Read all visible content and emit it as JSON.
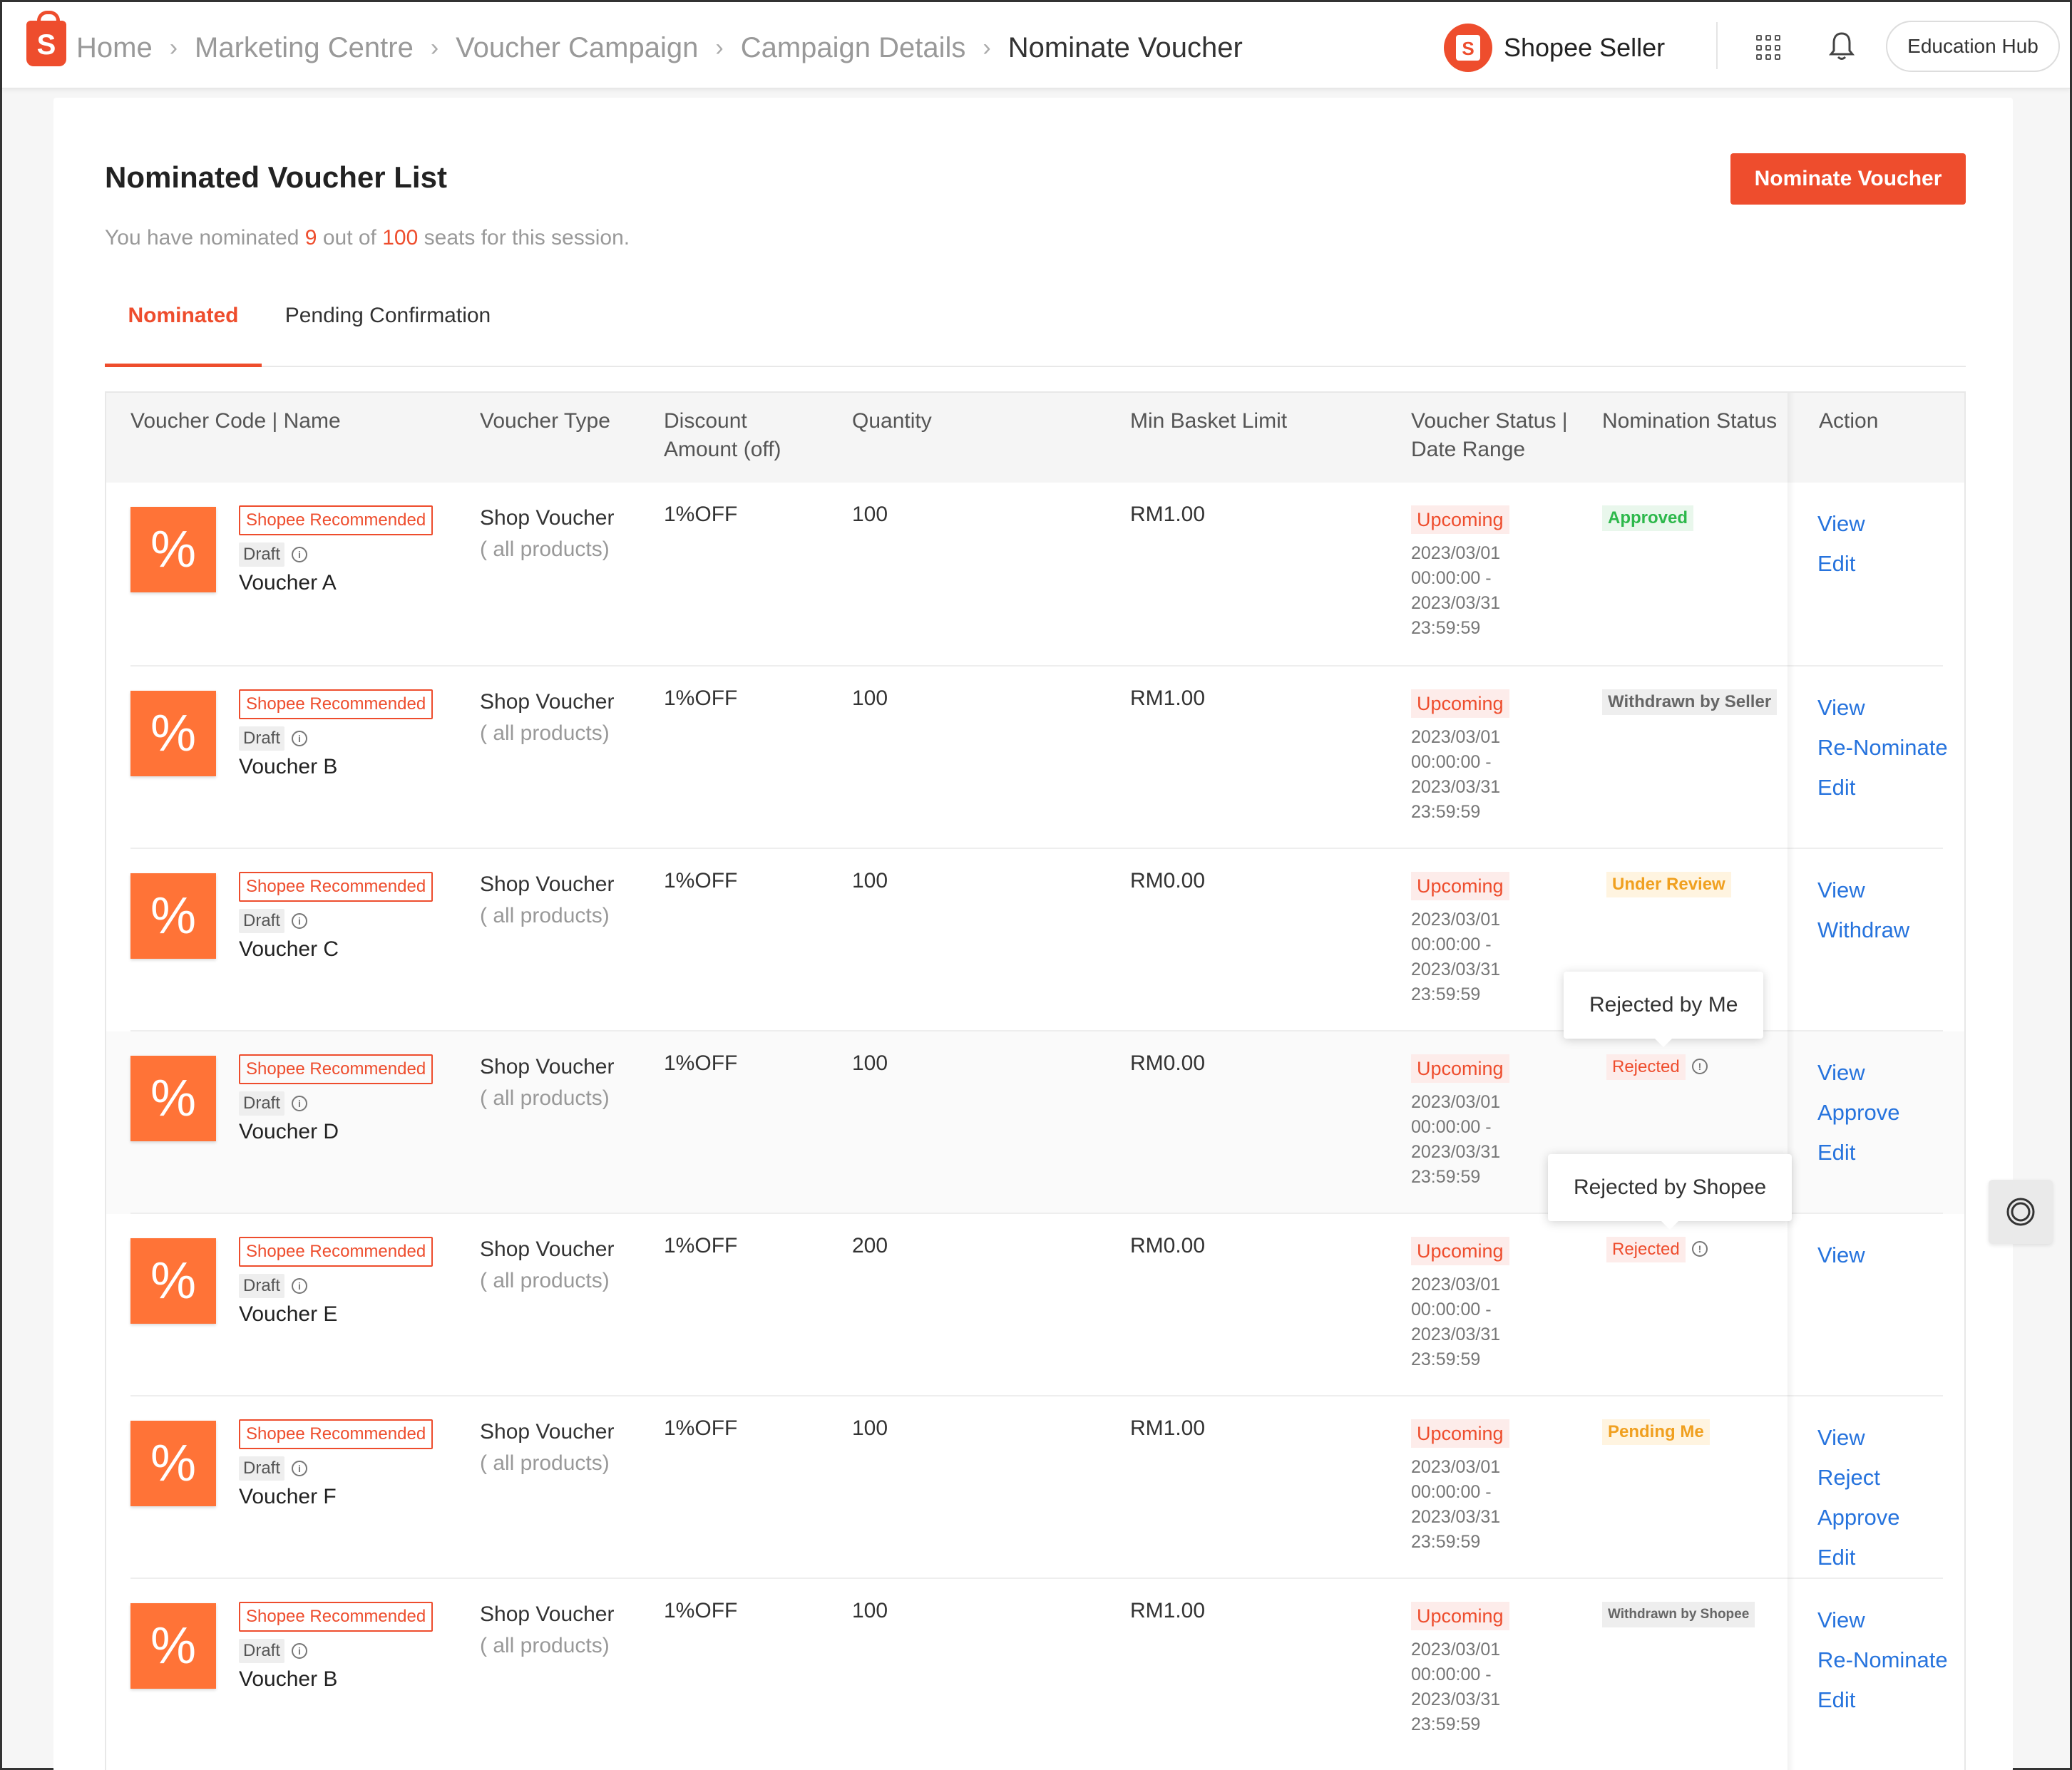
{
  "breadcrumb": [
    "Home",
    "Marketing Centre",
    "Voucher Campaign",
    "Campaign Details",
    "Nominate Voucher"
  ],
  "header": {
    "brand": "Shopee Seller",
    "education_hub": "Education Hub",
    "icons": [
      "shopee-logo-icon",
      "apps-grid-icon",
      "bell-icon"
    ]
  },
  "page": {
    "title": "Nominated Voucher List",
    "nominate_button": "Nominate Voucher",
    "seats_prefix": "You have nominated",
    "seats_used": "9",
    "seats_mid": "out of",
    "seats_total": "100",
    "seats_suffix": "seats for this session."
  },
  "tabs": [
    "Nominated",
    "Pending Confirmation"
  ],
  "active_tab": "Nominated",
  "table": {
    "headers": {
      "code": "Voucher Code | Name",
      "type": "Voucher Type",
      "discount_1": "Discount",
      "discount_2": "Amount (off)",
      "quantity": "Quantity",
      "min_basket": "Min Basket Limit",
      "status_1": "Voucher Status |",
      "status_2": "Date Range",
      "nomination": "Nomination Status",
      "action": "Action"
    },
    "rows": [
      {
        "rec": "Shopee Recommended",
        "draft": "Draft",
        "name": "Voucher A",
        "type": "Shop Voucher",
        "type_sub": "( all products)",
        "discount": "1%OFF",
        "quantity": "100",
        "min_basket": "RM1.00",
        "status": "Upcoming",
        "date_1": "2023/03/01",
        "date_2": "00:00:00 -",
        "date_3": "2023/03/31",
        "date_4": "23:59:59",
        "nomination": "Approved",
        "actions": [
          "View",
          "Edit"
        ]
      },
      {
        "rec": "Shopee Recommended",
        "draft": "Draft",
        "name": "Voucher B",
        "type": "Shop Voucher",
        "type_sub": "( all products)",
        "discount": "1%OFF",
        "quantity": "100",
        "min_basket": "RM1.00",
        "status": "Upcoming",
        "date_1": "2023/03/01",
        "date_2": "00:00:00 -",
        "date_3": "2023/03/31",
        "date_4": "23:59:59",
        "nomination": "Withdrawn by Seller",
        "actions": [
          "View",
          "Re-Nominate",
          "Edit"
        ]
      },
      {
        "rec": "Shopee Recommended",
        "draft": "Draft",
        "name": "Voucher C",
        "type": "Shop Voucher",
        "type_sub": "( all products)",
        "discount": "1%OFF",
        "quantity": "100",
        "min_basket": "RM0.00",
        "status": "Upcoming",
        "date_1": "2023/03/01",
        "date_2": "00:00:00 -",
        "date_3": "2023/03/31",
        "date_4": "23:59:59",
        "nomination": "Under Review",
        "actions": [
          "View",
          "Withdraw"
        ]
      },
      {
        "rec": "Shopee Recommended",
        "draft": "Draft",
        "name": "Voucher D",
        "type": "Shop Voucher",
        "type_sub": "( all products)",
        "discount": "1%OFF",
        "quantity": "100",
        "min_basket": "RM0.00",
        "status": "Upcoming",
        "date_1": "2023/03/01",
        "date_2": "00:00:00 -",
        "date_3": "2023/03/31",
        "date_4": "23:59:59",
        "nomination": "Rejected",
        "tooltip": "Rejected by Me",
        "actions": [
          "View",
          "Approve",
          "Edit"
        ]
      },
      {
        "rec": "Shopee Recommended",
        "draft": "Draft",
        "name": "Voucher E",
        "type": "Shop Voucher",
        "type_sub": "( all products)",
        "discount": "1%OFF",
        "quantity": "200",
        "min_basket": "RM0.00",
        "status": "Upcoming",
        "date_1": "2023/03/01",
        "date_2": "00:00:00 -",
        "date_3": "2023/03/31",
        "date_4": "23:59:59",
        "nomination": "Rejected",
        "tooltip": "Rejected by Shopee",
        "actions": [
          "View"
        ]
      },
      {
        "rec": "Shopee Recommended",
        "draft": "Draft",
        "name": "Voucher F",
        "type": "Shop Voucher",
        "type_sub": "( all products)",
        "discount": "1%OFF",
        "quantity": "100",
        "min_basket": "RM1.00",
        "status": "Upcoming",
        "date_1": "2023/03/01",
        "date_2": "00:00:00 -",
        "date_3": "2023/03/31",
        "date_4": "23:59:59",
        "nomination": "Pending Me",
        "actions": [
          "View",
          "Reject",
          "Approve",
          "Edit"
        ]
      },
      {
        "rec": "Shopee Recommended",
        "draft": "Draft",
        "name": "Voucher B",
        "type": "Shop Voucher",
        "type_sub": "( all products)",
        "discount": "1%OFF",
        "quantity": "100",
        "min_basket": "RM1.00",
        "status": "Upcoming",
        "date_1": "2023/03/01",
        "date_2": "00:00:00 -",
        "date_3": "2023/03/31",
        "date_4": "23:59:59",
        "nomination": "Withdrawn by Shopee",
        "actions": [
          "View",
          "Re-Nominate",
          "Edit"
        ]
      }
    ]
  },
  "thumb_glyph": "%",
  "colors": {
    "brand": "#ee4d2d",
    "thumb": "#ff7337",
    "link": "#2673dd",
    "approved": "#2db84b",
    "review": "#f0a020"
  }
}
